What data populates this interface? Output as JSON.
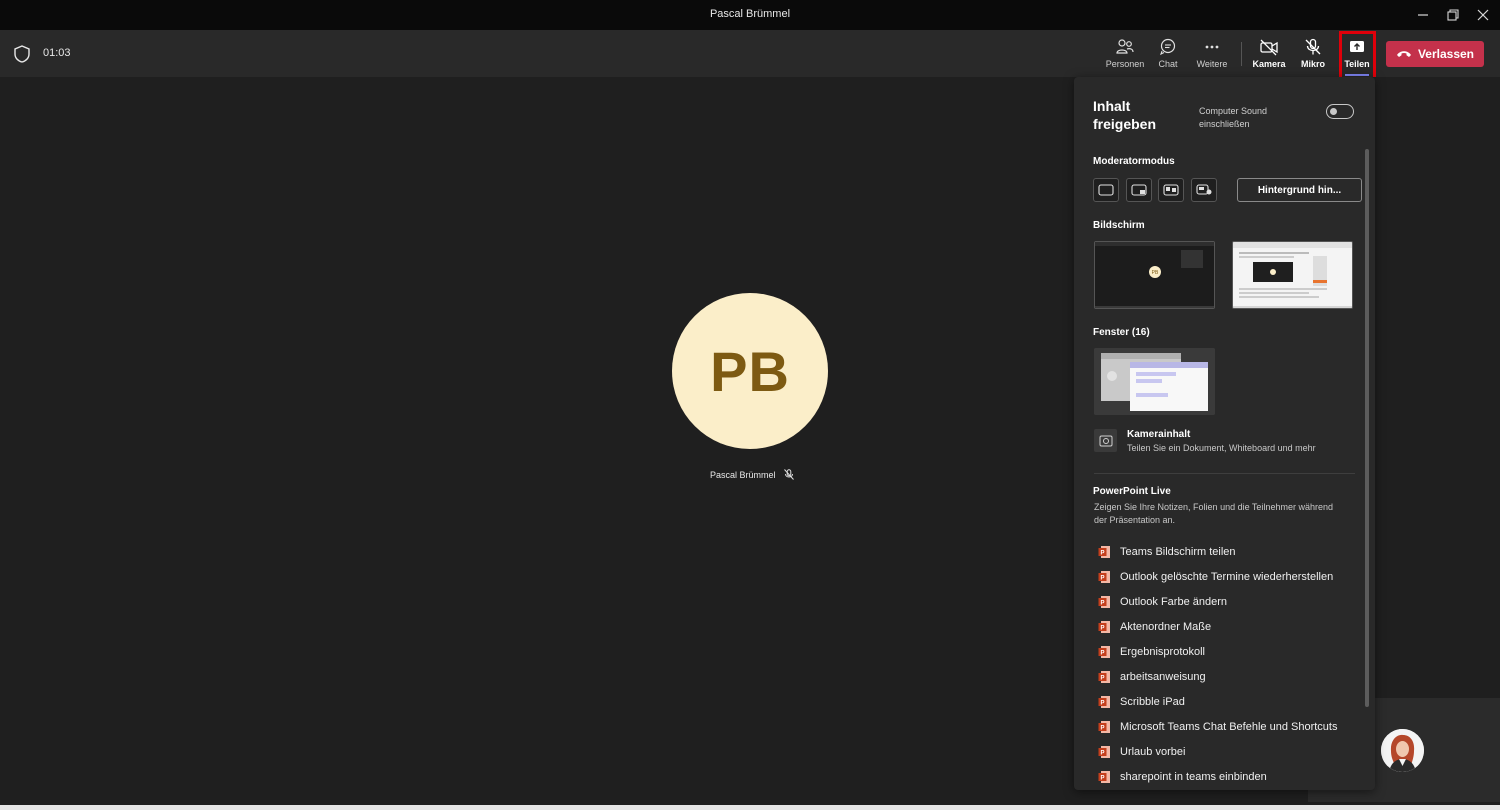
{
  "window": {
    "title": "Pascal Brümmel",
    "controls": [
      "minimize-icon",
      "restore-icon",
      "close-icon"
    ]
  },
  "toolbar": {
    "timer": "01:03",
    "buttons": {
      "people": "Personen",
      "chat": "Chat",
      "more": "Weitere",
      "camera": "Kamera",
      "mic": "Mikro",
      "share": "Teilen"
    },
    "leave": "Verlassen"
  },
  "stage": {
    "initials": "PB",
    "participant_name": "Pascal Brümmel"
  },
  "panel": {
    "title": "Inhalt freigeben",
    "computer_sound": "Computer Sound einschließen",
    "computer_sound_on": false,
    "presenter_mode": "Moderatormodus",
    "background_button": "Hintergrund hin...",
    "screen_section": "Bildschirm",
    "windows_section": "Fenster (16)",
    "camera_content": {
      "title": "Kamerainhalt",
      "subtitle": "Teilen Sie ein Dokument, Whiteboard und mehr"
    },
    "powerpoint": {
      "title": "PowerPoint Live",
      "subtitle": "Zeigen Sie Ihre Notizen, Folien und die Teilnehmer während der Präsentation an.",
      "files": [
        "Teams Bildschirm teilen",
        "Outlook gelöschte Termine wiederherstellen",
        "Outlook Farbe ändern",
        "Aktenordner Maße",
        "Ergebnisprotokoll",
        "arbeitsanweisung",
        "Scribble iPad",
        "Microsoft Teams Chat Befehle und Shortcuts",
        "Urlaub vorbei",
        "sharepoint in teams einbinden"
      ]
    }
  },
  "colors": {
    "accent": "#7f85f5",
    "leave": "#c4314b",
    "highlight": "#e0000a",
    "avatar_bg": "#fbeec9",
    "avatar_text": "#7d5a12"
  }
}
